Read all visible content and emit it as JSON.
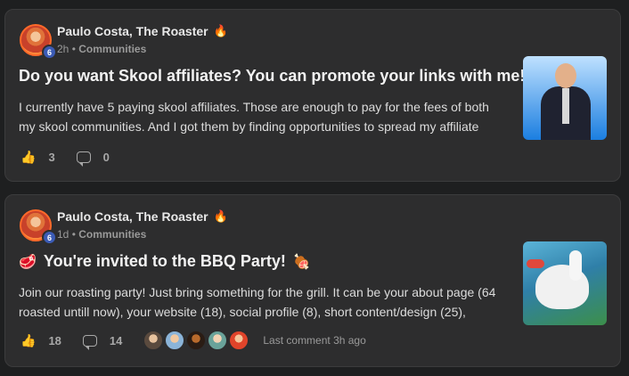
{
  "posts": [
    {
      "author": "Paulo Costa, The Roaster",
      "level": "6",
      "time": "2h",
      "category": "Communities",
      "title_emoji": "",
      "title": "Do you want Skool affiliates? You can promote your links with me!",
      "title_suffix_emoji": "",
      "body_line1": "I currently have 5 paying skool affiliates. Those are enough to pay for the fees of both",
      "body_line2": "my skool communities. And I got them by finding opportunities to spread my affiliate",
      "likes": "3",
      "comments": "0",
      "last_comment": ""
    },
    {
      "author": "Paulo Costa, The Roaster",
      "level": "6",
      "time": "1d",
      "category": "Communities",
      "title_emoji": "🥩",
      "title": "You're invited to the BBQ Party!",
      "title_suffix_emoji": "🍖",
      "body_line1": "Join our roasting party! Just bring something for the grill. It can be your about page (64",
      "body_line2": "roasted untill now), your website (18), social profile (8), short content/design (25),",
      "likes": "18",
      "comments": "14",
      "last_comment": "Last comment 3h ago"
    }
  ],
  "icons": {
    "fire": "🔥",
    "like": "👍",
    "separator": "•"
  },
  "colors": {
    "background": "#1e1f20",
    "card": "#2d2d2e",
    "level_badge": "#3b5bb5",
    "fire": "#ff7a1a"
  }
}
